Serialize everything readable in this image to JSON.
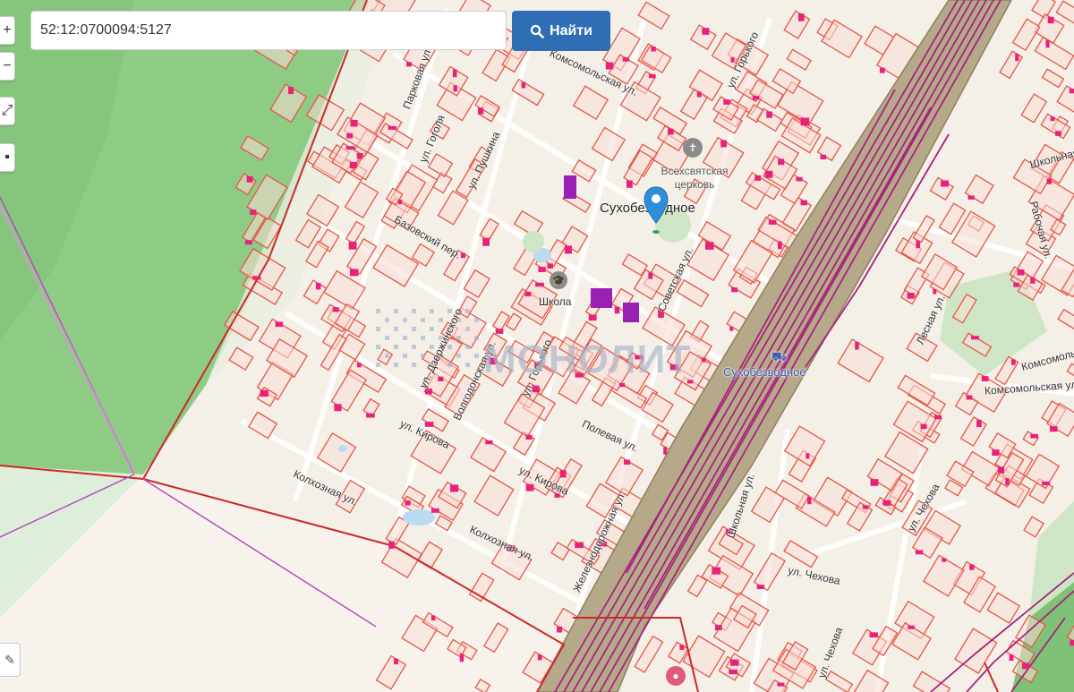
{
  "search": {
    "value": "52:12:0700094:5127",
    "button_label": "Найти"
  },
  "map_controls": {
    "zoom_in": "+",
    "zoom_out": "−",
    "measure": "⤢",
    "layers": "▪",
    "draw": "✎"
  },
  "labels": {
    "settlement_pin": "Сухобезводное",
    "church": "Всехсвятская церковь",
    "school": "Школа",
    "station": "Сухобезводное",
    "watermark": "МОНОЛИТ",
    "streets": {
      "parkovaya": "Парковая ул.",
      "gorkogo_top": "ул. Горького",
      "gorkogo_mid": "ул. Горького",
      "pushkina": "ул. Пушкина",
      "gogolya": "ул. Гоголя",
      "bazovsky": "Базовский пер.",
      "volgodonskaya": "Волгодонская ул.",
      "dzerzhinskogo": "ул. Дзержинского",
      "sovetskaya": "Советская ул.",
      "kirova_1": "ул. Кирова",
      "kirova_2": "ул. Кирова",
      "polevaya": "Полевая ул.",
      "kolkhoznaya_1": "Колхозная ул.",
      "kolkhoznaya_2": "Колхозная ул.",
      "zheleznodorozhnaya": "Железнодорожная ул.",
      "shkolnaya": "Школьная ул.",
      "chekhova_1": "ул. Чехова",
      "chekhova_2": "ул. Чехова",
      "chekhova_3": "ул. Чехова",
      "komsomolskaya": "Комсомольская ул.",
      "komsomolskaya_2": "Комсомольская",
      "lesnaya": "Лесная ул.",
      "rabochaya": "Рабочая ул.",
      "shkolnaya_2": "Школьная",
      "komsomolskaya_top": "Комсомольская ул.",
      "gorkogo_top2": "ул. Горького"
    }
  },
  "colors": {
    "forest": "#90cc86",
    "forest_dark": "#7dbf74",
    "land": "#f4efe7",
    "parcel_stroke": "#e5574a",
    "parcel_fill": "#f7d3c8",
    "building": "#e8227a",
    "rail": "#a8227d",
    "railway_bed": "#b5a98a",
    "boundary": "#cc2929",
    "search_button": "#2f6eb5",
    "pin": "#2e8fd8"
  },
  "icons": {
    "search": "search-icon",
    "pin": "map-pin-icon",
    "church": "church-icon",
    "school": "school-icon",
    "station": "train-station-icon"
  }
}
